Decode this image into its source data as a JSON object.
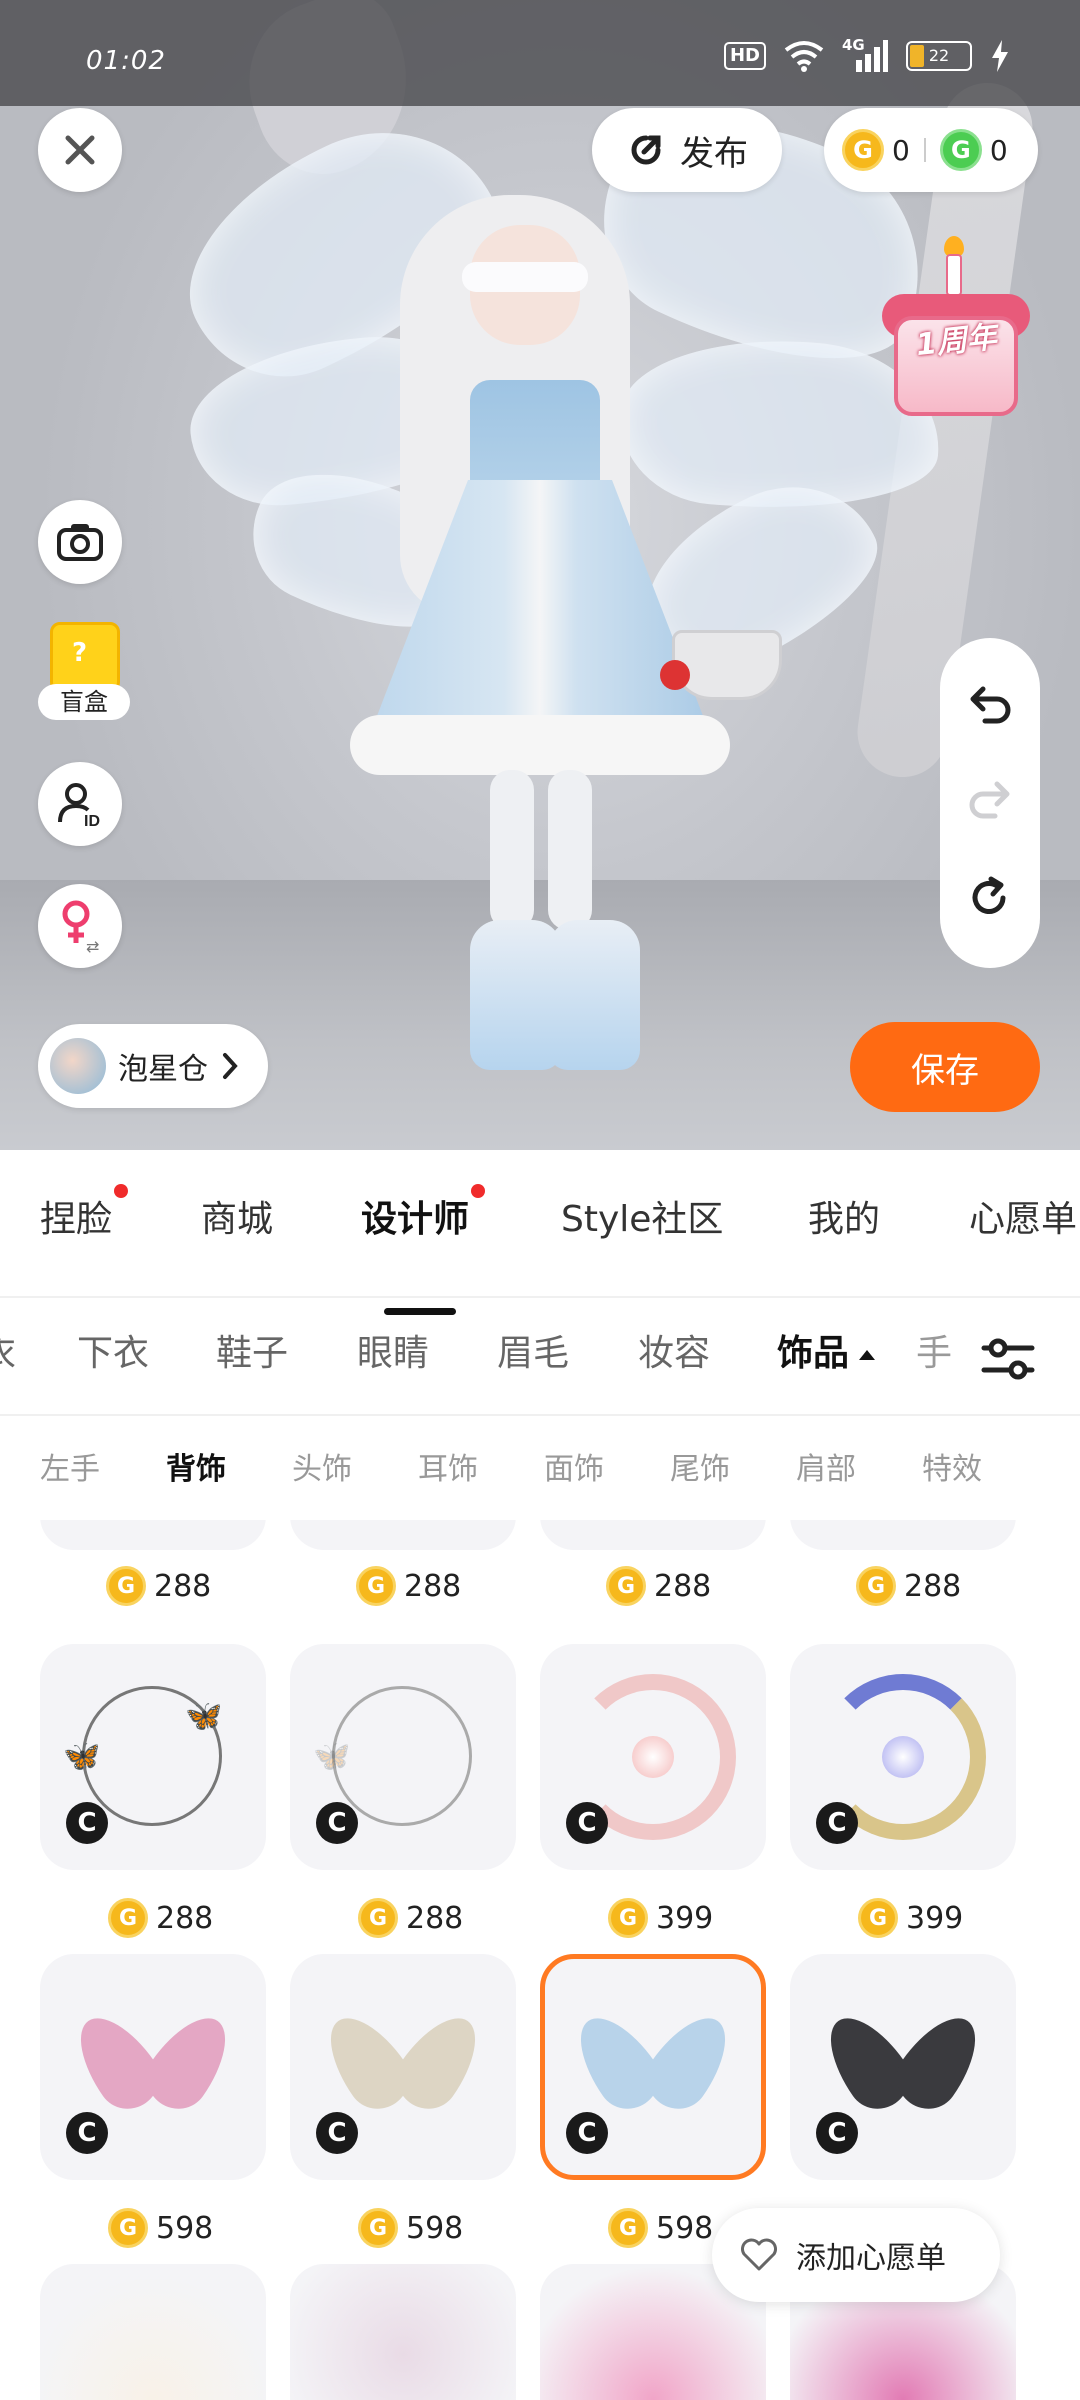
{
  "status_bar": {
    "time": "01:02",
    "hd": "HD",
    "network": "4G",
    "battery": "22"
  },
  "top_bar": {
    "publish_label": "发布",
    "coins": [
      {
        "type": "gold",
        "symbol": "G",
        "value": "0"
      },
      {
        "type": "green",
        "symbol": "G",
        "value": "0"
      }
    ]
  },
  "promo": {
    "anniversary_label": "1周年"
  },
  "side_controls": {
    "blind_box_label": "盲盒"
  },
  "storage": {
    "label": "泡星仓"
  },
  "save_label": "保存",
  "main_tabs": [
    {
      "label": "捏脸",
      "dot": true
    },
    {
      "label": "商城",
      "dot": false
    },
    {
      "label": "设计师",
      "dot": true,
      "active": true
    },
    {
      "label": "Style社区",
      "dot": false
    },
    {
      "label": "我的",
      "dot": false
    },
    {
      "label": "心愿单",
      "dot": false
    }
  ],
  "category_tabs": [
    {
      "label": "衣"
    },
    {
      "label": "下衣"
    },
    {
      "label": "鞋子"
    },
    {
      "label": "眼睛"
    },
    {
      "label": "眉毛"
    },
    {
      "label": "妆容"
    },
    {
      "label": "饰品",
      "active": true
    },
    {
      "label": "手"
    }
  ],
  "sub_tabs": [
    {
      "label": "左手"
    },
    {
      "label": "背饰",
      "active": true
    },
    {
      "label": "头饰"
    },
    {
      "label": "耳饰"
    },
    {
      "label": "面饰"
    },
    {
      "label": "尾饰"
    },
    {
      "label": "肩部"
    },
    {
      "label": "特效"
    }
  ],
  "items": {
    "row0_prices": [
      "288",
      "288",
      "288",
      "288"
    ],
    "row1": [
      {
        "price": "288",
        "badge": "C",
        "art": "butterfly-ring-dark"
      },
      {
        "price": "288",
        "badge": "C",
        "art": "butterfly-ring-light"
      },
      {
        "price": "399",
        "badge": "C",
        "art": "moon-pink"
      },
      {
        "price": "399",
        "badge": "C",
        "art": "moon-blue"
      }
    ],
    "row2": [
      {
        "price": "598",
        "badge": "C",
        "art": "wings-pink"
      },
      {
        "price": "598",
        "badge": "C",
        "art": "wings-cream"
      },
      {
        "price": "598",
        "badge": "C",
        "art": "wings-blue",
        "selected": true
      },
      {
        "price": "",
        "badge": "C",
        "art": "wings-black"
      }
    ]
  },
  "wishlist_label": "添加心愿单",
  "colors": {
    "accent": "#ff6a12",
    "coin_gold": "#f6b81c",
    "coin_green": "#4ccd52",
    "red_dot": "#f02b2b"
  }
}
